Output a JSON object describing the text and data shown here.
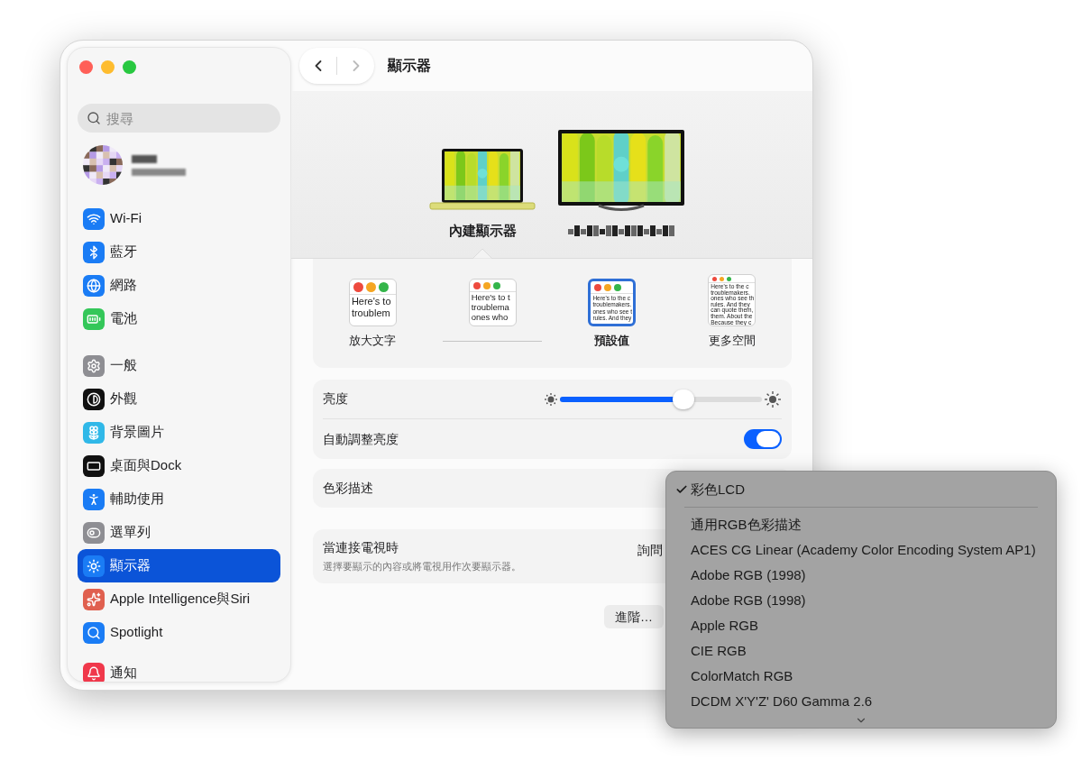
{
  "window": {
    "title": "顯示器"
  },
  "sidebar": {
    "search": {
      "placeholder": "搜尋"
    },
    "groups": [
      [
        {
          "label": "Wi-Fi",
          "selected": false
        },
        {
          "label": "藍牙",
          "selected": false
        },
        {
          "label": "網路",
          "selected": false
        },
        {
          "label": "電池",
          "selected": false
        }
      ],
      [
        {
          "label": "一般",
          "selected": false
        },
        {
          "label": "外觀",
          "selected": false
        },
        {
          "label": "背景圖片",
          "selected": false
        },
        {
          "label": "桌面與Dock",
          "selected": false
        },
        {
          "label": "輔助使用",
          "selected": false
        },
        {
          "label": "選單列",
          "selected": false
        },
        {
          "label": "顯示器",
          "selected": true
        },
        {
          "label": "Apple Intelligence與Siri",
          "selected": false
        },
        {
          "label": "Spotlight",
          "selected": false
        }
      ],
      [
        {
          "label": "通知",
          "selected": false
        }
      ]
    ]
  },
  "displays": [
    {
      "kind": "laptop",
      "label": "內建顯示器",
      "selected": true
    },
    {
      "kind": "monitor",
      "selected": false
    }
  ],
  "resolution_options": [
    {
      "label": "放大文字",
      "selected": false,
      "preview": [
        "Here's to",
        "troublem"
      ]
    },
    {
      "selected": false,
      "preview": [
        "Here's to t",
        "troublema",
        "ones who"
      ]
    },
    {
      "label": "預設值",
      "selected": true,
      "preview": [
        "Here's to the c",
        "troublemakers.",
        "ones who see t",
        "rules. And they"
      ]
    },
    {
      "label": "更多空間",
      "selected": false,
      "preview": [
        "Here's to the c",
        "troublemakers.",
        "ones who see th",
        "rules. And they",
        "can quote them,",
        "them. About the",
        "Because they c"
      ]
    }
  ],
  "brightness": {
    "label": "亮度",
    "level": 0.61
  },
  "auto_brightness": {
    "label": "自動調整亮度",
    "on": true
  },
  "color_profile": {
    "label": "色彩描述"
  },
  "tv": {
    "label": "當連接電視時",
    "description": "選擇要顯示的內容或將電視用作次要顯示器。",
    "value": "詢問"
  },
  "advanced_button": "進階…",
  "color_profile_menu": {
    "items": [
      {
        "label": "彩色LCD",
        "checked": true,
        "separator_after": true
      },
      {
        "label": "通用RGB色彩描述",
        "checked": false
      },
      {
        "label": "ACES CG Linear (Academy Color Encoding System AP1)",
        "checked": false
      },
      {
        "label": "Adobe RGB (1998)",
        "checked": false
      },
      {
        "label": "Adobe RGB (1998)",
        "checked": false
      },
      {
        "label": "Apple RGB",
        "checked": false
      },
      {
        "label": "CIE RGB",
        "checked": false
      },
      {
        "label": "ColorMatch RGB",
        "checked": false
      },
      {
        "label": "DCDM X'Y'Z' D60 Gamma 2.6",
        "checked": false
      }
    ]
  }
}
